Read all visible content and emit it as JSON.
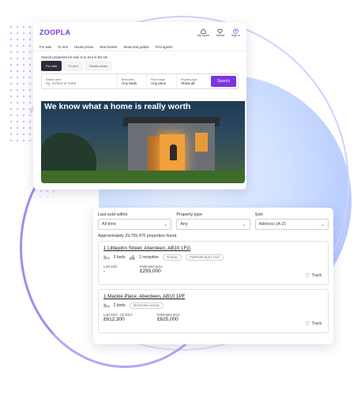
{
  "website": {
    "logo": "ZOOPLA",
    "top_icons": [
      {
        "label": "My home",
        "icon": "house-icon"
      },
      {
        "label": "Saved",
        "icon": "heart-icon"
      },
      {
        "label": "Sign in",
        "icon": "user-icon"
      }
    ],
    "nav": [
      "For sale",
      "To rent",
      "House prices",
      "New homes",
      "News and guides",
      "Find agents"
    ],
    "search_heading": "Search properties for sale or to rent in the UK",
    "tabs": [
      "For sale",
      "To rent",
      "House prices"
    ],
    "active_tab": "For sale",
    "search": {
      "search_area_label": "Search area",
      "search_area_placeholder": "eg. Oxford or NW3",
      "bedrooms_label": "Bedrooms",
      "bedrooms_value": "Any beds",
      "price_label": "Price range",
      "price_value": "Any price",
      "property_type_label": "Property type",
      "property_type_value": "Show all",
      "button": "Search"
    },
    "hero_headline": "We know what a home is really worth"
  },
  "results": {
    "filters": [
      {
        "label": "Last sold within",
        "value": "All time"
      },
      {
        "label": "Property type",
        "value": "Any"
      },
      {
        "label": "Sort",
        "value": "Address (A-Z)"
      }
    ],
    "count_text": "Approximately 29,755,470 properties found",
    "properties": [
      {
        "address": "1 Littlejohn Street, Aberdeen, AB10 1FG",
        "beds": "3 beds",
        "receptions": "1 reception",
        "tags": [
          "FEUDAL",
          "PURPOSE BUILT FLAT"
        ],
        "last_sold_label": "Last sold",
        "last_sold_value": "-",
        "estimated_label": "Estimated price",
        "estimated_value": "£293,000",
        "track": "Track"
      },
      {
        "address": "1 Mackie Place, Aberdeen, AB10 1PF",
        "beds": "2 beds",
        "receptions": "",
        "tags": [
          "DETACHED HOUSE"
        ],
        "last_sold_label": "Last sold - Jul 2013",
        "last_sold_value": "£612,300",
        "estimated_label": "Estimated price",
        "estimated_value": "£625,000",
        "track": "Track"
      }
    ]
  },
  "colors": {
    "brand": "#7b36e3",
    "dark": "#2b2b3a"
  }
}
